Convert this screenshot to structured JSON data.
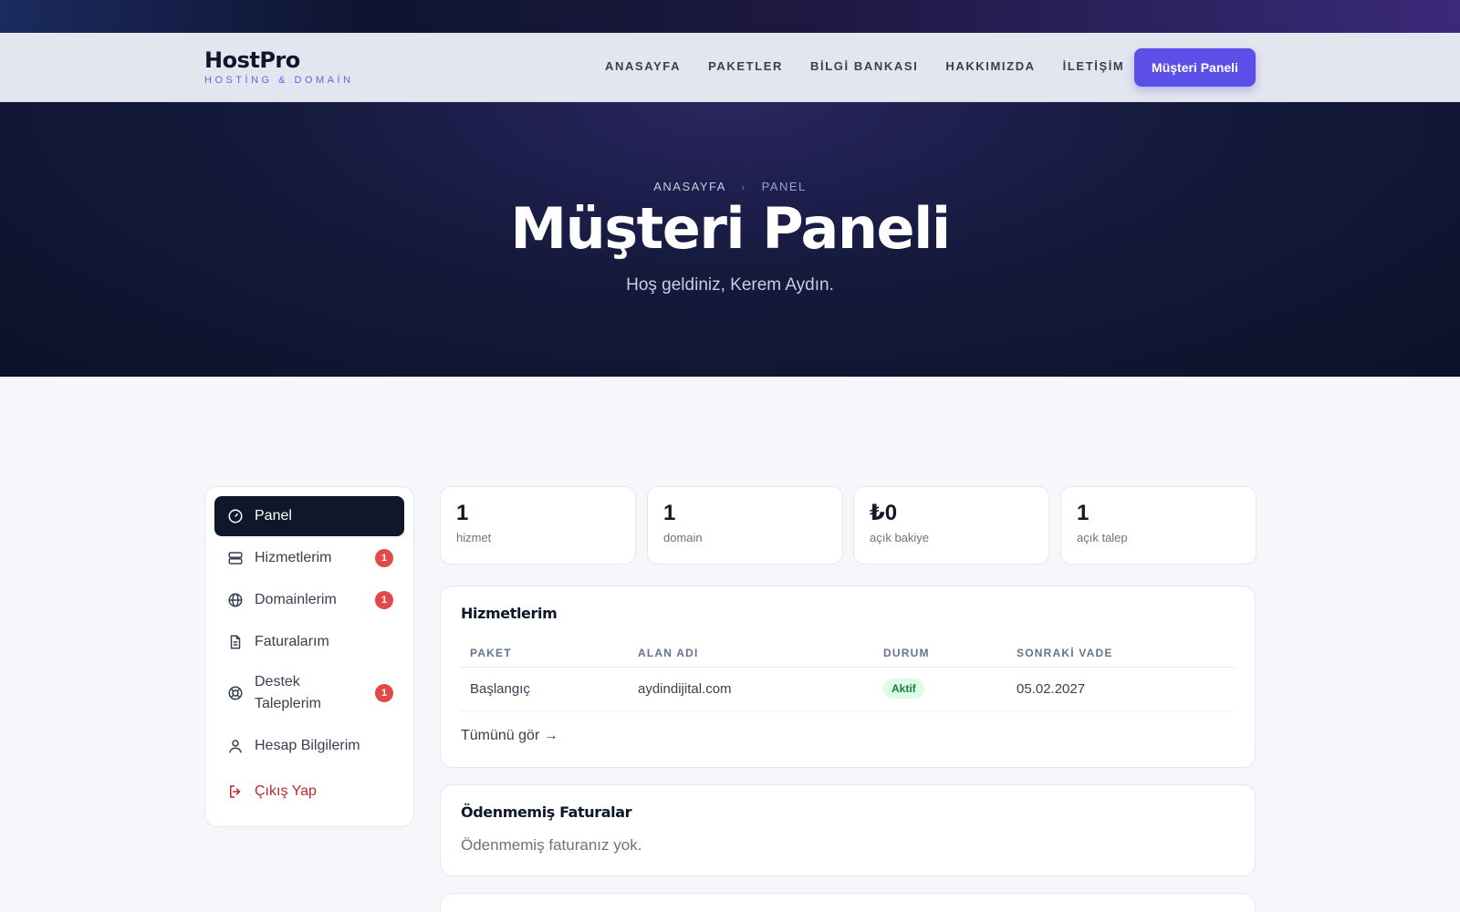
{
  "brand": {
    "name": "HostPro",
    "tagline": "HOSTİNG & DOMAİN"
  },
  "nav": {
    "links": [
      "ANASAYFA",
      "PAKETLER",
      "BİLGİ BANKASI",
      "HAKKIMIZDA",
      "İLETİŞİM"
    ],
    "cta": "Müşteri Paneli"
  },
  "hero": {
    "breadcrumb": {
      "home": "ANASAYFA",
      "current": "PANEL"
    },
    "title": "Müşteri Paneli",
    "subtitle": "Hoş geldiniz, Kerem Aydın."
  },
  "sidebar": {
    "items": [
      {
        "label": "Panel",
        "icon": "gauge-icon"
      },
      {
        "label": "Hizmetlerim",
        "icon": "server-icon",
        "badge": "1"
      },
      {
        "label": "Domainlerim",
        "icon": "globe-icon",
        "badge": "1"
      },
      {
        "label": "Faturalarım",
        "icon": "document-icon"
      },
      {
        "label": "Destek Taleplerim",
        "icon": "lifebuoy-icon",
        "badge": "1"
      },
      {
        "label": "Hesap Bilgilerim",
        "icon": "user-icon"
      },
      {
        "label": "Çıkış Yap",
        "icon": "logout-icon"
      }
    ]
  },
  "stats": [
    {
      "value": "1",
      "label": "hizmet"
    },
    {
      "value": "1",
      "label": "domain"
    },
    {
      "value": "₺0",
      "label": "açık bakiye"
    },
    {
      "value": "1",
      "label": "açık talep"
    }
  ],
  "services": {
    "title": "Hizmetlerim",
    "columns": [
      "PAKET",
      "ALAN ADI",
      "DURUM",
      "SONRAKİ VADE"
    ],
    "rows": [
      {
        "package": "Başlangıç",
        "domain": "aydindijital.com",
        "status": "Aktif",
        "due": "05.02.2027"
      }
    ],
    "see_all": "Tümünü gör →"
  },
  "invoices": {
    "title": "Ödenmemiş Faturalar",
    "empty": "Ödenmemiş faturanız yok."
  },
  "colors": {
    "accent": "#5b4fe8",
    "danger": "#e24a4a",
    "success": "#15803d"
  }
}
